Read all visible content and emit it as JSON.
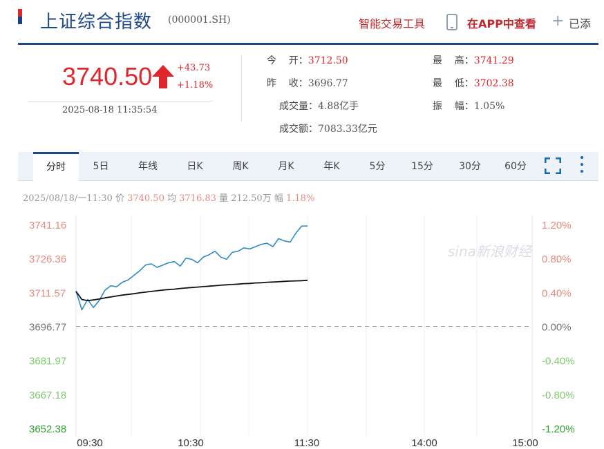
{
  "header": {
    "title": "上证综合指数",
    "code": "(000001.SH)",
    "tools_link": "智能交易工具",
    "app_link": "在APP中查看",
    "add_label": "已添"
  },
  "quote": {
    "price": "3740.50",
    "change": "+43.73",
    "change_pct": "+1.18%",
    "datetime": "2025-08-18 11:35:54"
  },
  "stats": {
    "open_label": "今    开：",
    "open": "3712.50",
    "prev_close_label": "昨    收：",
    "prev_close": "3696.77",
    "volume_label": "成交量：",
    "volume": "4.88亿手",
    "amount_label": "成交额：",
    "amount": "7083.33亿元",
    "high_label": "最    高：",
    "high": "3741.29",
    "low_label": "最    低：",
    "low": "3702.38",
    "amplitude_label": "振    幅：",
    "amplitude": "1.05%"
  },
  "tabs": [
    "分时",
    "5日",
    "年线",
    "日K",
    "周K",
    "月K",
    "年K",
    "5分",
    "15分",
    "30分",
    "60分"
  ],
  "active_tab": 0,
  "crosshair_info": {
    "datetime": "2025/08/18/一11:30",
    "price_label": "价",
    "price": "3740.50",
    "avg_label": "均",
    "avg": "3716.83",
    "vol_label": "量",
    "vol": "212.50万",
    "amp_label": "幅",
    "amp": "1.18%"
  },
  "watermark": "sina新浪财经",
  "colors": {
    "up": "#e0262b",
    "down": "#3daa3d",
    "price_line": "#2e8bc0",
    "avg_line": "#111111",
    "brand": "#1e4a8a"
  },
  "chart_data": {
    "type": "line",
    "prev_close": 3696.77,
    "y_ticks": [
      "3741.16",
      "3726.36",
      "3711.57",
      "3696.77",
      "3681.97",
      "3667.18",
      "3652.38"
    ],
    "pct_ticks": [
      "1.20%",
      "0.80%",
      "0.40%",
      "0.00%",
      "-0.40%",
      "-0.80%",
      "-1.20%"
    ],
    "x_ticks": [
      "09:30",
      "10:30",
      "11:30",
      "14:00",
      "15:00"
    ],
    "x": [
      "09:30",
      "09:33",
      "09:36",
      "09:39",
      "09:42",
      "09:45",
      "09:48",
      "09:51",
      "09:54",
      "09:57",
      "10:00",
      "10:03",
      "10:06",
      "10:09",
      "10:12",
      "10:15",
      "10:18",
      "10:21",
      "10:24",
      "10:27",
      "10:30",
      "10:33",
      "10:36",
      "10:39",
      "10:42",
      "10:45",
      "10:48",
      "10:51",
      "10:54",
      "10:57",
      "11:00",
      "11:03",
      "11:06",
      "11:09",
      "11:12",
      "11:15",
      "11:18",
      "11:21",
      "11:24",
      "11:27",
      "11:30"
    ],
    "series": [
      {
        "values": [
          3712.2,
          3704.0,
          3708.5,
          3705.0,
          3708.0,
          3712.5,
          3714.5,
          3714.0,
          3716.0,
          3717.0,
          3719.0,
          3721.0,
          3723.5,
          3724.0,
          3722.5,
          3723.5,
          3724.5,
          3725.0,
          3723.0,
          3726.5,
          3726.0,
          3724.5,
          3727.0,
          3728.0,
          3729.5,
          3727.0,
          3726.0,
          3729.0,
          3729.5,
          3731.0,
          3730.5,
          3731.5,
          3732.5,
          3733.0,
          3731.5,
          3735.0,
          3734.0,
          3733.5,
          3737.5,
          3740.5,
          3740.5
        ]
      },
      {
        "values": [
          3712.0,
          3708.5,
          3708.0,
          3708.3,
          3708.7,
          3709.2,
          3709.6,
          3710.0,
          3710.4,
          3710.7,
          3711.0,
          3711.4,
          3711.7,
          3712.0,
          3712.3,
          3712.6,
          3712.8,
          3713.0,
          3713.3,
          3713.5,
          3713.7,
          3713.9,
          3714.1,
          3714.3,
          3714.5,
          3714.7,
          3714.9,
          3715.0,
          3715.2,
          3715.4,
          3715.5,
          3715.7,
          3715.8,
          3716.0,
          3716.1,
          3716.2,
          3716.4,
          3716.5,
          3716.6,
          3716.7,
          3716.83
        ]
      }
    ]
  }
}
